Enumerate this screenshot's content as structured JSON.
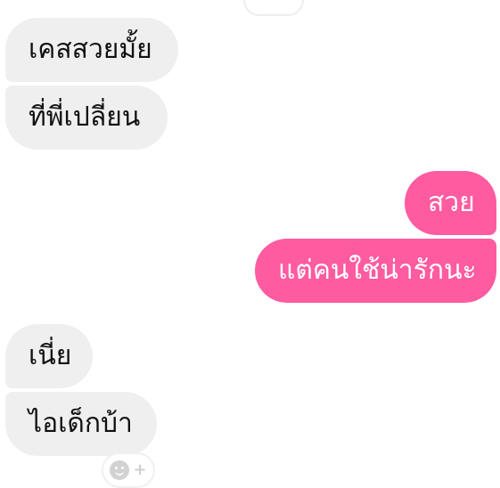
{
  "chat": {
    "messages": [
      {
        "side": "received",
        "text": "เคสสวยมั้ย"
      },
      {
        "side": "received",
        "text": "ที่พี่เปลี่ยน"
      },
      {
        "side": "sent",
        "text": "สวย"
      },
      {
        "side": "sent",
        "text": "แต่คนใช้น่ารักนะ"
      },
      {
        "side": "received",
        "text": "เนี่ย"
      },
      {
        "side": "received",
        "text": "ไอเด็กบ้า"
      }
    ],
    "reaction_icon": "smiley-plus-icon",
    "colors": {
      "sent_bubble": "#ff5ba0",
      "received_bubble": "#efefef"
    }
  }
}
